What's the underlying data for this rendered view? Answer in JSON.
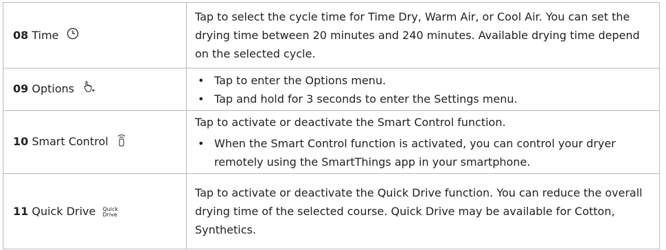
{
  "rows": [
    {
      "number": "08",
      "name": "Time",
      "icon": "clock-icon",
      "description": "Tap to select the cycle time for Time Dry, Warm Air, or Cool Air. You can set the drying time between 20 minutes and 240 minutes. Available drying time depend on the selected cycle."
    },
    {
      "number": "09",
      "name": "Options",
      "icon": "hand-plus-icon",
      "bullets": [
        "Tap to enter the Options menu.",
        "Tap and hold for 3 seconds to enter the Settings menu."
      ]
    },
    {
      "number": "10",
      "name": "Smart Control",
      "icon": "smart-control-icon",
      "description": "Tap to activate or deactivate the Smart Control function.",
      "bullets": [
        "When the Smart Control function is activated, you can control your dryer remotely using the SmartThings app in your smartphone."
      ]
    },
    {
      "number": "11",
      "name": "Quick Drive",
      "icon": "quick-drive-icon",
      "icon_text_top": "Quick",
      "icon_text_bottom": "Drive",
      "description": "Tap to activate or deactivate the Quick Drive function. You can reduce the overall drying time of the selected course. Quick Drive may be available for Cotton, Synthetics."
    }
  ]
}
